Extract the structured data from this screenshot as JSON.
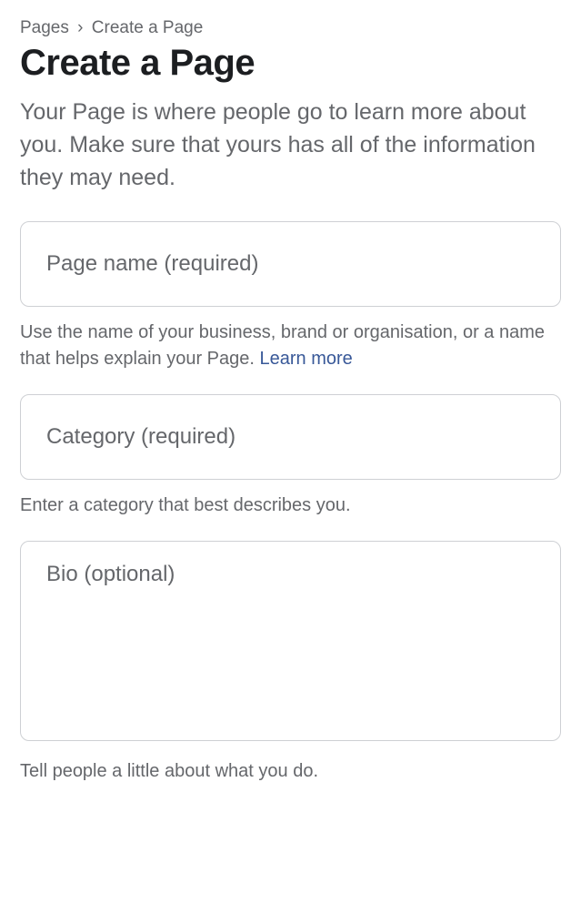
{
  "breadcrumb": {
    "parent": "Pages",
    "separator": "›",
    "current": "Create a Page"
  },
  "header": {
    "title": "Create a Page",
    "description": "Your Page is where people go to learn more about you. Make sure that yours has all of the information they may need."
  },
  "fields": {
    "page_name": {
      "placeholder": "Page name (required)",
      "helper": "Use the name of your business, brand or organisation, or a name that helps explain your Page. ",
      "learn_more": "Learn more"
    },
    "category": {
      "placeholder": "Category (required)",
      "helper": "Enter a category that best describes you."
    },
    "bio": {
      "placeholder": "Bio (optional)",
      "helper": "Tell people a little about what you do."
    }
  }
}
